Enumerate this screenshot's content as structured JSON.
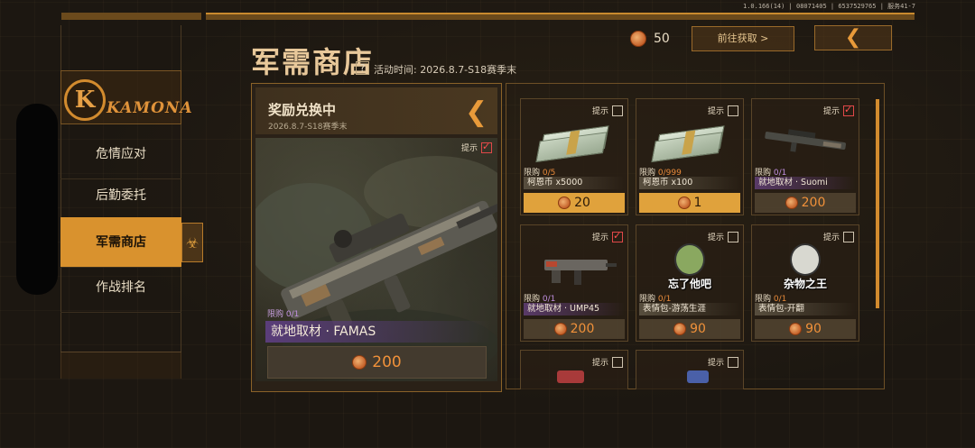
{
  "version_text": "1.0.166(14) | 08071405 | 65375297​65 | 服务41-7",
  "sidebar": {
    "logo_letter": "K",
    "logo_text": "KAMONA",
    "items": [
      {
        "label": "危情应对",
        "active": false
      },
      {
        "label": "后勤委托",
        "active": false
      },
      {
        "label": "军需商店",
        "active": true
      },
      {
        "label": "作战排名",
        "active": false
      }
    ]
  },
  "header": {
    "title": "军需商店",
    "help_glyph": "?",
    "activity_time": "活动时间: 2026.8.7-S18赛季末",
    "currency_amount": "50",
    "get_more_label": "前往获取 >",
    "back_glyph": "❮"
  },
  "featured": {
    "title": "奖励兑换中",
    "subtitle": "2026.8.7-S18赛季末",
    "tip_label": "提示",
    "tip_checked": true,
    "limit_label": "限购",
    "limit_value": "0/1",
    "name": "就地取材 · FAMAS",
    "price": "200"
  },
  "items": [
    {
      "tip": "提示",
      "checked": false,
      "limit_label": "限购",
      "limit_value": "0/5",
      "name": "柯恩币 x5000",
      "price": "20",
      "price_style": "gold",
      "rarity": "normal",
      "pic": "cash"
    },
    {
      "tip": "提示",
      "checked": false,
      "limit_label": "限购",
      "limit_value": "0/999",
      "name": "柯恩币 x100",
      "price": "1",
      "price_style": "gold",
      "rarity": "normal",
      "pic": "cash"
    },
    {
      "tip": "提示",
      "checked": true,
      "limit_label": "限购",
      "limit_value": "0/1",
      "name": "就地取材 · Suomi",
      "price": "200",
      "price_style": "dark",
      "rarity": "purple",
      "pic": "rifle"
    },
    {
      "tip": "提示",
      "checked": true,
      "limit_label": "限购",
      "limit_value": "0/1",
      "name": "就地取材 · UMP45",
      "price": "200",
      "price_style": "dark",
      "rarity": "purple",
      "pic": "smg"
    },
    {
      "tip": "提示",
      "checked": false,
      "limit_label": "限购",
      "limit_value": "0/1",
      "name": "表情包-游荡生涯",
      "price": "90",
      "price_style": "dark",
      "rarity": "normal",
      "pic": "sticker",
      "sticker_text": "忘了他吧"
    },
    {
      "tip": "提示",
      "checked": false,
      "limit_label": "限购",
      "limit_value": "0/1",
      "name": "表情包-开翻",
      "price": "90",
      "price_style": "dark",
      "rarity": "normal",
      "pic": "sticker",
      "sticker_text": "杂物之王"
    },
    {
      "tip": "提示",
      "checked": false,
      "pic": "partial"
    },
    {
      "tip": "提示",
      "checked": false,
      "pic": "partial"
    }
  ]
}
